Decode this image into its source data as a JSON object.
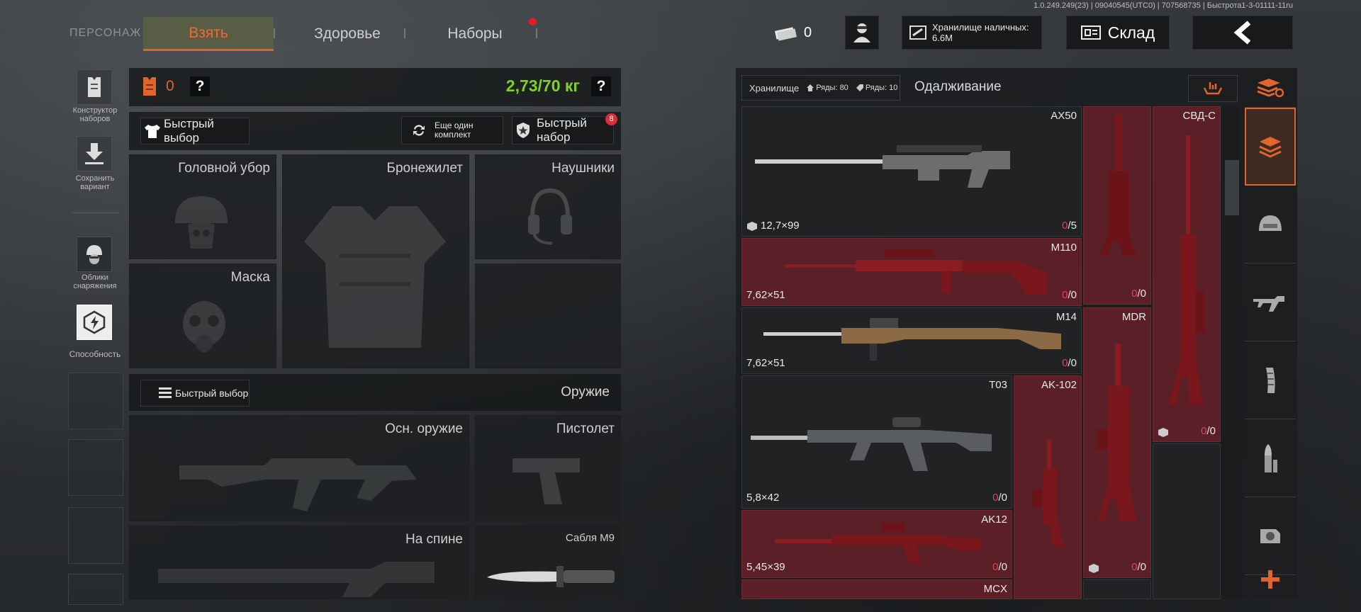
{
  "version_line": "1.0.249.249(23) | 09040545(UTC0) | 707568735 | Быстрота1-3-01111-11ru",
  "nav": {
    "section": "ПЕРСОНАЖ",
    "tabs": [
      {
        "label": "Взять",
        "active": true
      },
      {
        "label": "Здоровье",
        "active": false
      },
      {
        "label": "Наборы",
        "active": false,
        "notification": true
      }
    ]
  },
  "header": {
    "money": "0",
    "cash_storage": "Хранилище наличных: 6.6M",
    "warehouse": "Склад"
  },
  "left_sidebar": [
    {
      "label": "Конструктор наборов",
      "icon": "vest-builder-icon"
    },
    {
      "label": "Сохранить вариант",
      "icon": "download-icon"
    },
    {
      "label": "Облики снаряжения",
      "icon": "helmet-skin-icon"
    },
    {
      "label": "Способность",
      "icon": "ability-icon"
    }
  ],
  "loadout": {
    "armor_count": "0",
    "weight": "2,73/70 кг",
    "quick_select": "Быстрый выбор",
    "another_kit": "Еще один комплект",
    "quick_kit": "Быстрый набор",
    "quick_kit_badge": "8",
    "slots": {
      "headgear": "Головной убор",
      "armor": "Бронежилет",
      "headset": "Наушники",
      "mask": "Маска"
    },
    "weapons_header": "Оружие",
    "weapons_quick_select": "Быстрый выбор",
    "weapon_slots": {
      "primary": "Осн. оружие",
      "pistol": "Пистолет",
      "back": "На спине",
      "melee": "Сабля М9"
    }
  },
  "storage": {
    "title": "Хранилище",
    "rows_a": "Ряды: 80",
    "rows_b": "Ряды: 10",
    "borrow_tab": "Одалживание",
    "weapons": [
      {
        "name": "AX50",
        "caliber": "12,7×99",
        "count_zero": "0",
        "count_total": "/5",
        "available": true
      },
      {
        "name": "M110",
        "caliber": "7,62×51",
        "count_zero": "0",
        "count_total": "/0",
        "available": false
      },
      {
        "name": "M14",
        "caliber": "7,62×51",
        "count_zero": "0",
        "count_total": "/0",
        "available": false
      },
      {
        "name": "T03",
        "caliber": "5,8×42",
        "count_zero": "0",
        "count_total": "/0",
        "available": false
      },
      {
        "name": "AK12",
        "caliber": "5,45×39",
        "count_zero": "0",
        "count_total": "/0",
        "available": false
      },
      {
        "name": "MCX",
        "caliber": "",
        "count_zero": "",
        "count_total": "",
        "available": false
      },
      {
        "name": "СВД-С",
        "caliber": "",
        "count_zero": "0",
        "count_total": "/0",
        "available": false
      },
      {
        "name": "MDR",
        "caliber": "",
        "count_zero": "0",
        "count_total": "/0",
        "available": false
      },
      {
        "name": "AK-102",
        "caliber": "",
        "count_zero": "",
        "count_total": "",
        "available": false
      }
    ],
    "misc_counts": {
      "col2_row1_zero": "0",
      "col2_row1_total": "/0"
    }
  },
  "colors": {
    "accent": "#e0642b",
    "weight_ok": "#7ed321",
    "locked_bg": "#5b2027",
    "zero_count": "#e0405a"
  }
}
